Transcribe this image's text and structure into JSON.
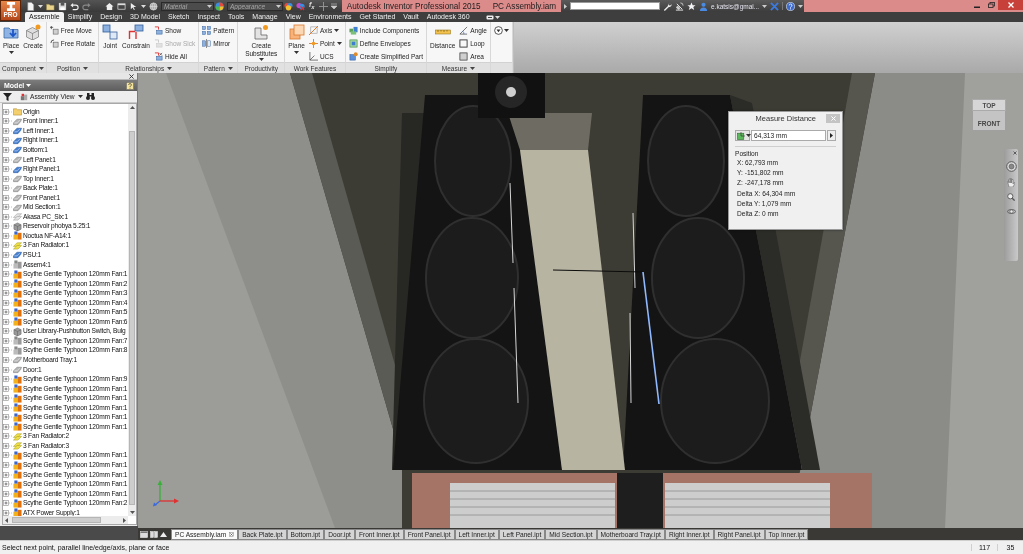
{
  "title_bar": {
    "app_badge": "PRO",
    "material": {
      "placeholder": "Material"
    },
    "appearance": {
      "placeholder": "Appearance"
    },
    "parameters": "f$_{x}$",
    "title": "Autodesk Inventor Professional 2015",
    "document": "PC Assembly.iam",
    "user": "e.katsis@gmai..."
  },
  "ribbon": {
    "tabs": [
      {
        "label": "Assemble",
        "selected": true
      },
      {
        "label": "Simplify",
        "selected": false
      },
      {
        "label": "Design",
        "selected": false
      },
      {
        "label": "3D Model",
        "selected": false
      },
      {
        "label": "Sketch",
        "selected": false
      },
      {
        "label": "Inspect",
        "selected": false
      },
      {
        "label": "Tools",
        "selected": false
      },
      {
        "label": "Manage",
        "selected": false
      },
      {
        "label": "View",
        "selected": false
      },
      {
        "label": "Environments",
        "selected": false
      },
      {
        "label": "Get Started",
        "selected": false
      },
      {
        "label": "Vault",
        "selected": false
      },
      {
        "label": "Autodesk 360",
        "selected": false
      }
    ],
    "groups": [
      {
        "label": "Component",
        "menu": true,
        "tools": [
          {
            "label": "Place",
            "kind": "large",
            "menu": true,
            "disabled": false
          },
          {
            "label": "Create",
            "kind": "large",
            "menu": false,
            "disabled": false
          }
        ]
      },
      {
        "label": "Position",
        "menu": true,
        "tools": [
          {
            "label": "Free Move",
            "kind": "small",
            "menu": false,
            "disabled": false
          },
          {
            "label": "Free Rotate",
            "kind": "small",
            "menu": false,
            "disabled": false
          }
        ]
      },
      {
        "label": "Relationships",
        "menu": true,
        "tools": [
          {
            "label": "Joint",
            "kind": "large",
            "menu": false,
            "disabled": false
          },
          {
            "label": "Constrain",
            "kind": "large",
            "menu": false,
            "disabled": false
          },
          {
            "label": "Show",
            "kind": "small",
            "menu": false,
            "disabled": false
          },
          {
            "label": "Show Sick",
            "kind": "small",
            "menu": false,
            "disabled": true
          },
          {
            "label": "Hide All",
            "kind": "small",
            "menu": false,
            "disabled": false
          }
        ]
      },
      {
        "label": "Pattern",
        "menu": true,
        "tools": [
          {
            "label": "Pattern",
            "kind": "small",
            "menu": false,
            "disabled": false
          },
          {
            "label": "Mirror",
            "kind": "small",
            "menu": false,
            "disabled": false
          }
        ]
      },
      {
        "label": "Productivity",
        "menu": false,
        "tools": [
          {
            "label": "Create Substitutes",
            "kind": "large",
            "menu": true,
            "disabled": false
          }
        ]
      },
      {
        "label": "Work Features",
        "menu": false,
        "tools": [
          {
            "label": "Plane",
            "kind": "large",
            "menu": true,
            "disabled": false
          },
          {
            "label": "Axis",
            "kind": "small",
            "menu": true,
            "disabled": false
          },
          {
            "label": "Point",
            "kind": "small",
            "menu": true,
            "disabled": false
          },
          {
            "label": "UCS",
            "kind": "small",
            "menu": false,
            "disabled": false
          }
        ]
      },
      {
        "label": "Simplify",
        "menu": false,
        "tools": [
          {
            "label": "Include Components",
            "kind": "small",
            "menu": false,
            "disabled": false
          },
          {
            "label": "Define Envelopes",
            "kind": "small",
            "menu": false,
            "disabled": false
          },
          {
            "label": "Create Simplified Part",
            "kind": "small",
            "menu": false,
            "disabled": false
          }
        ]
      },
      {
        "label": "Measure",
        "menu": true,
        "tools": [
          {
            "label": "Distance",
            "kind": "large",
            "menu": false,
            "disabled": false
          },
          {
            "label": "Angle",
            "kind": "small",
            "menu": false,
            "disabled": false
          },
          {
            "label": "Loop",
            "kind": "small",
            "menu": false,
            "disabled": false
          },
          {
            "label": "Area",
            "kind": "small",
            "menu": false,
            "disabled": false
          }
        ]
      }
    ]
  },
  "browser": {
    "title": "Model",
    "view": "Assembly View",
    "items": [
      {
        "label": "Origin",
        "kind": "folder",
        "visible": true,
        "expanded": false
      },
      {
        "label": "Front Inner:1",
        "kind": "part",
        "visible": false,
        "expanded": false
      },
      {
        "label": "Left Inner:1",
        "kind": "part",
        "visible": true,
        "expanded": false
      },
      {
        "label": "Right Inner:1",
        "kind": "part",
        "visible": true,
        "expanded": false
      },
      {
        "label": "Bottom:1",
        "kind": "part",
        "visible": true,
        "expanded": false
      },
      {
        "label": "Left Panel:1",
        "kind": "part",
        "visible": false,
        "expanded": false
      },
      {
        "label": "Right Panel:1",
        "kind": "part",
        "visible": true,
        "expanded": false
      },
      {
        "label": "Top Inner:1",
        "kind": "part",
        "visible": false,
        "expanded": false
      },
      {
        "label": "Back Plate:1",
        "kind": "part",
        "visible": false,
        "expanded": false
      },
      {
        "label": "Front Panel:1",
        "kind": "part",
        "visible": false,
        "expanded": false
      },
      {
        "label": "Mid Section:1",
        "kind": "part",
        "visible": false,
        "expanded": false
      },
      {
        "label": "Akasa PC_Six:1",
        "kind": "sheet",
        "visible": false,
        "expanded": false
      },
      {
        "label": "Reservoir phobya 5.25:1",
        "kind": "block",
        "visible": true,
        "expanded": false
      },
      {
        "label": "Noctua NF-A14:1",
        "kind": "assembly",
        "visible": true,
        "expanded": false
      },
      {
        "label": "3 Fan Radiator:1",
        "kind": "sheet",
        "visible": true,
        "expanded": false
      },
      {
        "label": "PSU:1",
        "kind": "part",
        "visible": true,
        "expanded": false
      },
      {
        "label": "Assem4:1",
        "kind": "assembly",
        "visible": false,
        "expanded": false
      },
      {
        "label": "Scythe Gentle Typhoon 120mm Fan:1",
        "kind": "assembly",
        "visible": true,
        "expanded": false
      },
      {
        "label": "Scythe Gentle Typhoon 120mm Fan:2",
        "kind": "assembly",
        "visible": true,
        "expanded": false
      },
      {
        "label": "Scythe Gentle Typhoon 120mm Fan:3",
        "kind": "assembly",
        "visible": true,
        "expanded": false
      },
      {
        "label": "Scythe Gentle Typhoon 120mm Fan:4",
        "kind": "assembly",
        "visible": true,
        "expanded": false
      },
      {
        "label": "Scythe Gentle Typhoon 120mm Fan:5",
        "kind": "assembly",
        "visible": true,
        "expanded": false
      },
      {
        "label": "Scythe Gentle Typhoon 120mm Fan:6",
        "kind": "assembly",
        "visible": true,
        "expanded": false
      },
      {
        "label": "User Library-Pushbutton Switch, Bulg",
        "kind": "block",
        "visible": true,
        "expanded": false
      },
      {
        "label": "Scythe Gentle Typhoon 120mm Fan:7",
        "kind": "assembly",
        "visible": false,
        "expanded": false
      },
      {
        "label": "Scythe Gentle Typhoon 120mm Fan:8",
        "kind": "assembly",
        "visible": false,
        "expanded": false
      },
      {
        "label": "Motherboard Tray:1",
        "kind": "part",
        "visible": false,
        "expanded": false
      },
      {
        "label": "Door:1",
        "kind": "part",
        "visible": false,
        "expanded": false
      },
      {
        "label": "Scythe Gentle Typhoon 120mm Fan:9",
        "kind": "assembly",
        "visible": true,
        "expanded": false
      },
      {
        "label": "Scythe Gentle Typhoon 120mm Fan:1",
        "kind": "assembly",
        "visible": true,
        "expanded": false
      },
      {
        "label": "Scythe Gentle Typhoon 120mm Fan:1",
        "kind": "assembly",
        "visible": true,
        "expanded": false
      },
      {
        "label": "Scythe Gentle Typhoon 120mm Fan:1",
        "kind": "assembly",
        "visible": true,
        "expanded": false
      },
      {
        "label": "Scythe Gentle Typhoon 120mm Fan:1",
        "kind": "assembly",
        "visible": true,
        "expanded": false
      },
      {
        "label": "Scythe Gentle Typhoon 120mm Fan:1",
        "kind": "assembly",
        "visible": true,
        "expanded": false
      },
      {
        "label": "3 Fan Radiator:2",
        "kind": "sheet",
        "visible": true,
        "expanded": false
      },
      {
        "label": "3 Fan Radiator:3",
        "kind": "sheet",
        "visible": true,
        "expanded": false
      },
      {
        "label": "Scythe Gentle Typhoon 120mm Fan:1",
        "kind": "assembly",
        "visible": true,
        "expanded": false
      },
      {
        "label": "Scythe Gentle Typhoon 120mm Fan:1",
        "kind": "assembly",
        "visible": true,
        "expanded": false
      },
      {
        "label": "Scythe Gentle Typhoon 120mm Fan:1",
        "kind": "assembly",
        "visible": true,
        "expanded": false
      },
      {
        "label": "Scythe Gentle Typhoon 120mm Fan:1",
        "kind": "assembly",
        "visible": true,
        "expanded": false
      },
      {
        "label": "Scythe Gentle Typhoon 120mm Fan:1",
        "kind": "assembly",
        "visible": true,
        "expanded": false
      },
      {
        "label": "Scythe Gentle Typhoon 120mm Fan:2",
        "kind": "assembly",
        "visible": true,
        "expanded": false
      },
      {
        "label": "ATX Power Supply:1",
        "kind": "assembly",
        "visible": true,
        "expanded": false
      }
    ]
  },
  "viewport": {
    "view_cube": {
      "top": "TOP",
      "front": "FRONT"
    },
    "measure_dialog": {
      "title": "Measure Distance",
      "value": "64,313 mm",
      "section": "Position",
      "readings": [
        "X: 62,793 mm",
        "Y: -151,802 mm",
        "Z: -247,178 mm",
        "Delta X: 64,304 mm",
        "Delta Y: 1,079 mm",
        "Delta Z: 0 mm"
      ]
    }
  },
  "doc_tabs": [
    {
      "label": "PC Assembly.iam",
      "selected": true
    },
    {
      "label": "Back Plate.ipt",
      "selected": false
    },
    {
      "label": "Bottom.ipt",
      "selected": false
    },
    {
      "label": "Door.ipt",
      "selected": false
    },
    {
      "label": "Front Inner.ipt",
      "selected": false
    },
    {
      "label": "Front Panel.ipt",
      "selected": false
    },
    {
      "label": "Left Inner.ipt",
      "selected": false
    },
    {
      "label": "Left Panel.ipt",
      "selected": false
    },
    {
      "label": "Mid Section.ipt",
      "selected": false
    },
    {
      "label": "Motherboard Tray.ipt",
      "selected": false
    },
    {
      "label": "Right Inner.ipt",
      "selected": false
    },
    {
      "label": "Right Panel.ipt",
      "selected": false
    },
    {
      "label": "Top Inner.ipt",
      "selected": false
    }
  ],
  "status_bar": {
    "message": "Select next point, parallel line/edge/axis, plane or face",
    "readings": [
      "117",
      "35"
    ]
  }
}
